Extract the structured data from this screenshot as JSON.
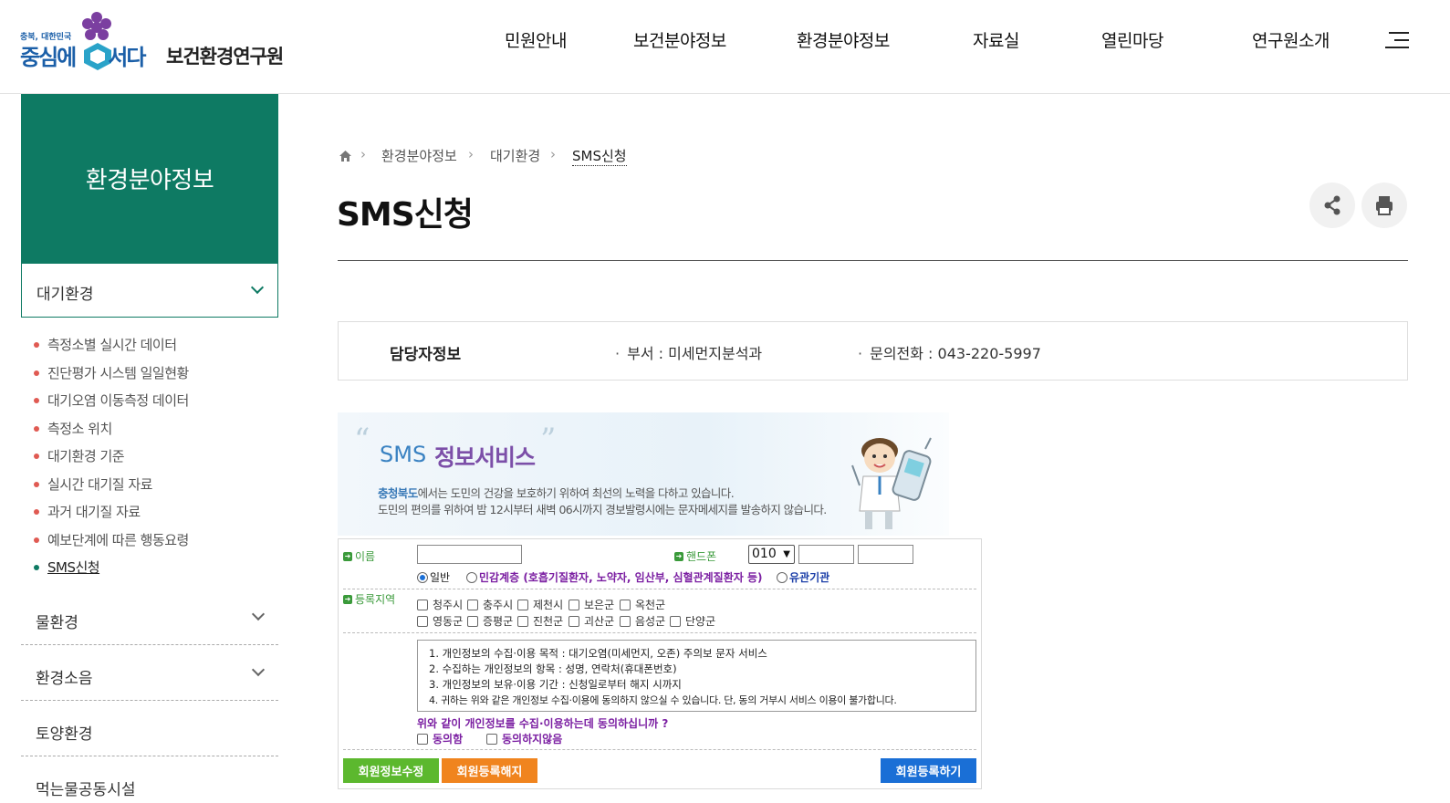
{
  "header": {
    "logo_small": "충북, 대한민국",
    "logo_left": "중심에",
    "logo_right": "서다",
    "logo_org": "보건환경연구원",
    "nav": [
      "민원안내",
      "보건분야정보",
      "환경분야정보",
      "자료실",
      "열린마당",
      "연구원소개"
    ]
  },
  "sidebar": {
    "title": "환경분야정보",
    "current": "대기환경",
    "sub_items": [
      {
        "label": "측정소별 실시간 데이터",
        "active": false
      },
      {
        "label": "진단평가 시스템 일일현황",
        "active": false
      },
      {
        "label": "대기오염 이동측정 데이터",
        "active": false
      },
      {
        "label": "측정소 위치",
        "active": false
      },
      {
        "label": "대기환경 기준",
        "active": false
      },
      {
        "label": "실시간 대기질 자료",
        "active": false
      },
      {
        "label": "과거 대기질 자료",
        "active": false
      },
      {
        "label": "예보단계에 따른 행동요령",
        "active": false
      },
      {
        "label": "SMS신청",
        "active": true
      }
    ],
    "other_menus": [
      "물환경",
      "환경소음",
      "토양환경",
      "먹는물공동시설"
    ]
  },
  "breadcrumb": [
    "환경분야정보",
    "대기환경",
    "SMS신청"
  ],
  "page_title": "SMS신청",
  "manager": {
    "label": "담당자정보",
    "dept": "부서 : 미세먼지분석과",
    "phone": "문의전화 : 043-220-5997"
  },
  "banner": {
    "sms": "SMS",
    "service": "정보서비스",
    "line1_strong": "충청북도",
    "line1_rest": "에서는 도민의 건강을 보호하기 위하여 최선의 노력을 다하고 있습니다.",
    "line2": "도민의 편의를 위하여 밤 12시부터 새벽 06시까지 경보발령시에는 문자메세지를 발송하지 않습니다."
  },
  "form": {
    "name_label": "이름",
    "phone_label": "핸드폰",
    "phone_prefix": "010",
    "radio_general": "일반",
    "radio_sensitive": "민감계층 (호흡기질환자, 노약자, 임산부, 심혈관계질환자 등)",
    "radio_agency": "유관기관",
    "region_label": "등록지역",
    "regions_row1": [
      "청주시",
      "충주시",
      "제천시",
      "보은군",
      "옥천군"
    ],
    "regions_row2": [
      "영동군",
      "증평군",
      "진천군",
      "괴산군",
      "음성군",
      "단양군"
    ],
    "terms": [
      "1. 개인정보의 수집·이용 목적 : 대기오염(미세먼지, 오존) 주의보 문자 서비스",
      "2. 수집하는 개인정보의 항목 : 성명, 연락처(휴대폰번호)",
      "3. 개인정보의 보유·이용 기간 : 신청일로부터 해지 시까지",
      "4. 귀하는 위와 같은 개인정보 수집·이용에 동의하지 않으실 수 있습니다. 단, 동의 거부시 서비스 이용이 불가합니다."
    ],
    "question": "위와 같이 개인정보를 수집·이용하는데 동의하십니까 ?",
    "agree": "동의함",
    "disagree": "동의하지않음",
    "btn_edit": "회원정보수정",
    "btn_cancel": "회원등록해지",
    "btn_register": "회원등록하기"
  },
  "colors": {
    "brand_green": "#0e7a63",
    "btn_green": "#5cb82e",
    "btn_orange": "#f0841e",
    "btn_blue": "#1a6fd6"
  }
}
